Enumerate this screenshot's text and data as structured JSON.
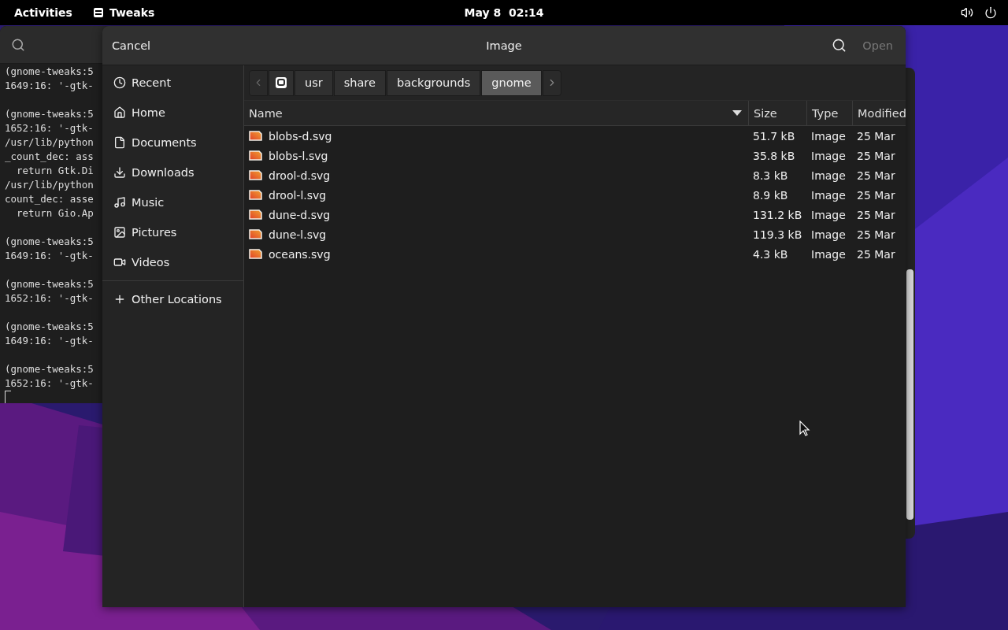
{
  "top_bar": {
    "activities": "Activities",
    "app": "Tweaks",
    "clock": "May 8  02:14"
  },
  "terminal": {
    "blocks": [
      [
        "(gnome-tweaks:5",
        "1649:16: '-gtk-"
      ],
      [
        "(gnome-tweaks:5",
        "1652:16: '-gtk-",
        "/usr/lib/python",
        "_count_dec: ass",
        "  return Gtk.Di",
        "/usr/lib/python",
        "count_dec: asse",
        "  return Gio.Ap"
      ],
      [
        "(gnome-tweaks:5",
        "1649:16: '-gtk-"
      ],
      [
        "(gnome-tweaks:5",
        "1652:16: '-gtk-"
      ],
      [
        "(gnome-tweaks:5",
        "1649:16: '-gtk-"
      ],
      [
        "(gnome-tweaks:5",
        "1652:16: '-gtk-"
      ]
    ]
  },
  "dialog": {
    "cancel": "Cancel",
    "title": "Image",
    "open": {
      "label": "Open",
      "disabled": true
    },
    "sidebar": {
      "places": [
        {
          "label": "Recent",
          "kind": "recent"
        },
        {
          "label": "Home",
          "kind": "home"
        },
        {
          "label": "Documents",
          "kind": "documents"
        },
        {
          "label": "Downloads",
          "kind": "downloads"
        },
        {
          "label": "Music",
          "kind": "music"
        },
        {
          "label": "Pictures",
          "kind": "pictures"
        },
        {
          "label": "Videos",
          "kind": "videos"
        }
      ],
      "other_locations": "Other Locations"
    },
    "path_bar": [
      {
        "kind": "root",
        "selected": false
      },
      {
        "kind": "folder",
        "label": "usr",
        "selected": false
      },
      {
        "kind": "folder",
        "label": "share",
        "selected": false
      },
      {
        "kind": "folder",
        "label": "backgrounds",
        "selected": false
      },
      {
        "kind": "folder",
        "label": "gnome",
        "selected": true
      }
    ],
    "table": {
      "columns": [
        "Name",
        "Size",
        "Type",
        "Modified"
      ],
      "rows": [
        [
          "blobs-d.svg",
          "51.7 kB",
          "Image",
          "25 Mar"
        ],
        [
          "blobs-l.svg",
          "35.8 kB",
          "Image",
          "25 Mar"
        ],
        [
          "drool-d.svg",
          "8.3 kB",
          "Image",
          "25 Mar"
        ],
        [
          "drool-l.svg",
          "8.9 kB",
          "Image",
          "25 Mar"
        ],
        [
          "dune-d.svg",
          "131.2 kB",
          "Image",
          "25 Mar"
        ],
        [
          "dune-l.svg",
          "119.3 kB",
          "Image",
          "25 Mar"
        ],
        [
          "oceans.svg",
          "4.3 kB",
          "Image",
          "25 Mar"
        ]
      ]
    }
  }
}
